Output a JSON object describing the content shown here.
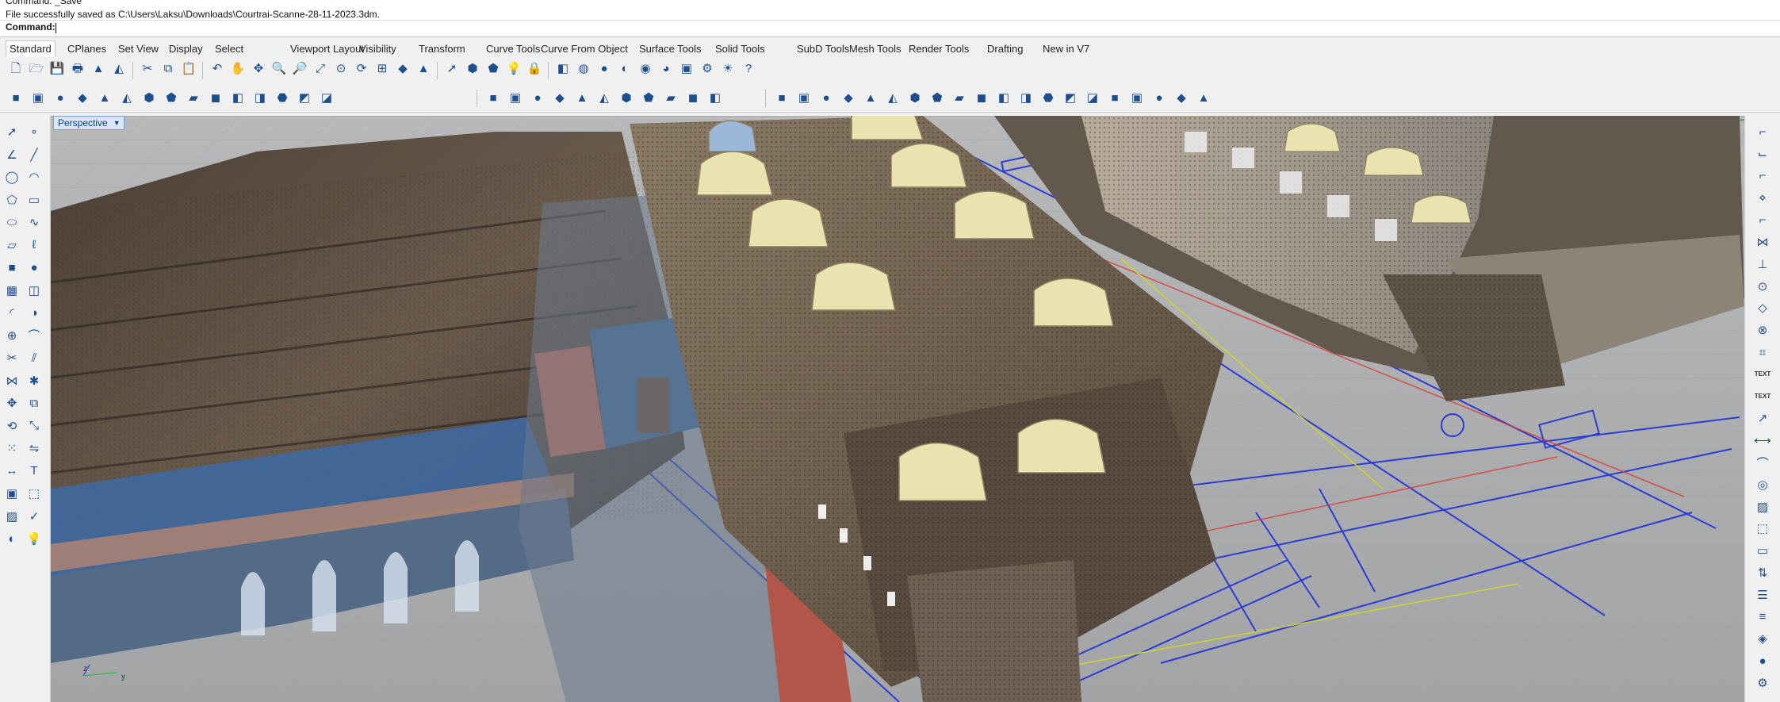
{
  "command": {
    "history": [
      "Command: _Save",
      "File successfully saved as C:\\Users\\Laksu\\Downloads\\Courtrai-Scanne-28-11-2023.3dm."
    ],
    "prompt_label": "Command:",
    "input_value": ""
  },
  "tabs": [
    "Standard",
    "CPlanes",
    "Set View",
    "Display",
    "Select",
    "Viewport Layout",
    "Visibility",
    "Transform",
    "Curve Tools",
    "Curve From Object",
    "Surface Tools",
    "Solid Tools",
    "SubD Tools",
    "Mesh Tools",
    "Render Tools",
    "Drafting",
    "New in V7"
  ],
  "active_tab": "Standard",
  "toolbar1_icons": [
    "new-file-icon",
    "open-file-icon",
    "save-icon",
    "print-icon",
    "import-icon",
    "export-icon",
    "cut-icon",
    "copy-icon",
    "paste-icon",
    "undo-icon",
    "pan-hand-icon",
    "move-icon",
    "zoom-window-icon",
    "zoom-dynamic-icon",
    "zoom-extents-icon",
    "zoom-selected-icon",
    "rotate-view-icon",
    "four-viewports-icon",
    "cplane-icon",
    "named-views-icon",
    "select-icon",
    "filter-icon",
    "zoom-target-icon",
    "lightbulb-icon",
    "lock-icon",
    "layer-icon",
    "color-wheel-icon",
    "render-sphere-icon",
    "shaded-sphere-icon",
    "rendered-sphere-icon",
    "material-sphere-icon",
    "analysis-icon",
    "gear-icon",
    "sun-icon",
    "help-icon"
  ],
  "toolbar2_groups": [
    [
      "box-icon",
      "cylinder-icon",
      "sphere-icon",
      "ellipsoid-icon",
      "paraboloid-icon",
      "cone-icon",
      "truncated-cone-icon",
      "pyramid-icon",
      "tetrahedron-icon",
      "tube-icon",
      "torus-icon",
      "pipe-icon",
      "extrude-icon",
      "box-edge-icon",
      "solid-options-icon"
    ],
    [
      "boolean-union-icon",
      "boolean-difference-icon",
      "boolean-intersection-icon",
      "boolean-split-icon",
      "cap-icon",
      "fillet-edge-icon",
      "chamfer-edge-icon",
      "shell-icon",
      "blend-edge-icon",
      "extract-surface-icon",
      "merge-faces-icon"
    ],
    [
      "plane-icon",
      "surface-from-points-icon",
      "edge-surface-icon",
      "loft-icon",
      "sweep-1-icon",
      "sweep-2-icon",
      "revolve-icon",
      "rail-revolve-icon",
      "patch-icon",
      "network-surface-icon",
      "extrude-curve-icon",
      "offset-surface-icon",
      "blend-surface-icon",
      "trim-icon",
      "split-icon",
      "untrim-icon",
      "mesh-icon",
      "point-cloud-icon",
      "analyze-icon",
      "render-icon"
    ]
  ],
  "viewport": {
    "label": "Perspective",
    "axis_labels": [
      "z",
      "y"
    ]
  },
  "left_toolbar_icons": [
    "select-arrow-icon",
    "point-icon",
    "polyline-icon",
    "line-icon",
    "circle-icon",
    "arc-icon",
    "polygon-icon",
    "rectangle-icon",
    "ellipse-icon",
    "curve-icon",
    "surface-plane-icon",
    "freeform-curve-icon",
    "solid-box-icon",
    "sphere-icon",
    "mesh-box-icon",
    "surface-icon",
    "fillet-icon",
    "offset-icon",
    "boolean-icon",
    "blend-icon",
    "trim-icon",
    "split-icon",
    "join-icon",
    "explode-icon",
    "move-icon",
    "copy-icon",
    "rotate-icon",
    "scale-icon",
    "array-icon",
    "mirror-icon",
    "dimension-icon",
    "text-icon",
    "group-icon",
    "block-icon",
    "hatch-icon",
    "check-icon",
    "analysis-icon",
    "lightbulb-icon"
  ],
  "right_toolbar_icons": [
    "osnap-end-icon",
    "osnap-near-icon",
    "osnap-point-icon",
    "osnap-mid-icon",
    "osnap-center-icon",
    "osnap-int-icon",
    "osnap-perp-icon",
    "osnap-tan-icon",
    "osnap-quad-icon",
    "osnap-knot-icon",
    "osnap-vertex-icon",
    "text-label",
    "text-label",
    "leader-icon",
    "dimension-icon",
    "radius-icon",
    "bubble-icon",
    "hatch-icon",
    "block-icon",
    "layout-icon",
    "draw-order-icon",
    "properties-icon",
    "layers-icon",
    "materials-icon",
    "render-ball-icon",
    "settings-icon"
  ],
  "right_text_labels": [
    "TEXT",
    "TEXT"
  ],
  "colors": {
    "accent_blue": "#1f4e8c",
    "viewport_bg": "#a9abad",
    "label_bg": "#d7e5f6"
  }
}
